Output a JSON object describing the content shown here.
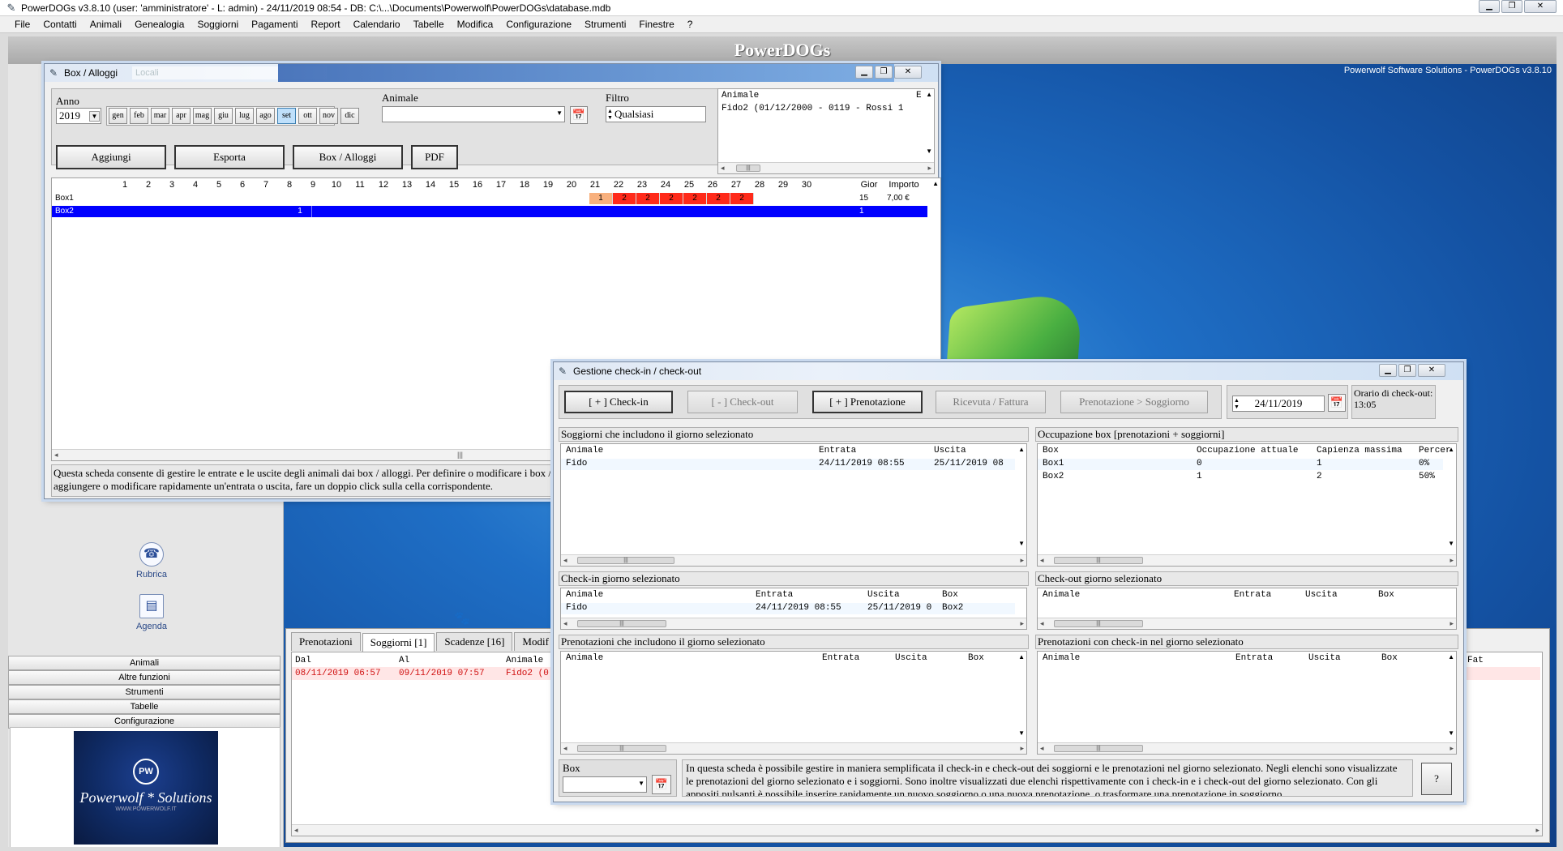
{
  "titlebar": {
    "title": "PowerDOGs v3.8.10  (user: 'amministratore'  - L: admin) - 24/11/2019 08:54 - DB: C:\\...\\Documents\\Powerwolf\\PowerDOGs\\database.mdb"
  },
  "menu": [
    "File",
    "Contatti",
    "Animali",
    "Genealogia",
    "Soggiorni",
    "Pagamenti",
    "Report",
    "Calendario",
    "Tabelle",
    "Modifica",
    "Configurazione",
    "Strumenti",
    "Finestre",
    "?"
  ],
  "banner": {
    "title": "PowerDOGs"
  },
  "desktop": {
    "caption": "Powerwolf Software Solutions - PowerDOGs v3.8.10"
  },
  "left_panel": {
    "launchers": [
      {
        "label": "Rubrica",
        "icon": "phone-icon"
      },
      {
        "label": "Agenda",
        "icon": "agenda-icon"
      }
    ],
    "nav": [
      "Animali",
      "Altre funzioni",
      "Strumenti",
      "Tabelle",
      "Configurazione"
    ],
    "logo": {
      "mark": "PW",
      "text": "Powerwolf * Solutions",
      "subtext": "WWW.POWERWOLF.IT"
    }
  },
  "bottom_tabs": {
    "tabs": [
      "Prenotazioni",
      "Soggiorni [1]",
      "Scadenze [16]",
      "Modif"
    ],
    "active": 1,
    "columns": [
      "Dal",
      "Al",
      "Animale",
      "Fat"
    ],
    "rows": [
      {
        "dal": "08/11/2019 06:57",
        "al": "09/11/2019 07:57",
        "animale": "Fido2 (0"
      }
    ]
  },
  "box_window": {
    "title": "Box / Alloggi",
    "title_extra": "Locali",
    "anno_label": "Anno",
    "anno_value": "2019",
    "months": [
      "gen",
      "feb",
      "mar",
      "apr",
      "mag",
      "giu",
      "lug",
      "ago",
      "set",
      "ott",
      "nov",
      "dic"
    ],
    "selected_month": "set",
    "animale_label": "Animale",
    "animale_value": "",
    "filtro_label": "Filtro",
    "filtro_value": "Qualsiasi",
    "animal_list_header": "Animale",
    "animal_list_header2": "E",
    "animal_list_item": "Fido2 (01/12/2000 - 0119 - Rossi  1",
    "buttons": {
      "aggiungi": "Aggiungi",
      "esporta": "Esporta",
      "box": "Box / Alloggi",
      "pdf": "PDF"
    },
    "grid": {
      "days": [
        "1",
        "2",
        "3",
        "4",
        "5",
        "6",
        "7",
        "8",
        "9",
        "10",
        "11",
        "12",
        "13",
        "14",
        "15",
        "16",
        "17",
        "18",
        "19",
        "20",
        "21",
        "22",
        "23",
        "24",
        "25",
        "26",
        "27",
        "28",
        "29",
        "30"
      ],
      "col_gior": "Gior",
      "col_importo": "Importo",
      "rows": [
        {
          "name": "Box1",
          "cells": {
            "21": "1",
            "22": "2",
            "23": "2",
            "24": "2",
            "25": "2",
            "26": "2",
            "27": "2"
          },
          "gior": "15",
          "importo": "7,00 €"
        },
        {
          "name": "Box2",
          "cells": {
            "8": "1"
          },
          "gior": "1",
          "importo": ""
        }
      ]
    },
    "help_text": "Questa scheda consente di gestire le entrate e le uscite degli animali dai box / alloggi. Per definire o modificare i box / alloggi, selezionare Tabelle > Box / Alloggi nel menù principale per l'edit dei box). Per aggiungere o modificare rapidamente un'entrata o uscita, fare un doppio click sulla cella corrispondente."
  },
  "checkin_window": {
    "title": "Gestione check-in / check-out",
    "buttons": {
      "checkin": "[ + ] Check-in",
      "checkout": "[ - ] Check-out",
      "prenotazione": "[ + ] Prenotazione",
      "ricevuta": "Ricevuta / Fattura",
      "prenot_soggiorno": "Prenotazione > Soggiorno"
    },
    "date_value": "24/11/2019",
    "orario_label": "Orario di check-out: 13:05",
    "soggiorni": {
      "title": "Soggiorni che includono il giorno selezionato",
      "columns": [
        "Animale",
        "Entrata",
        "Uscita"
      ],
      "rows": [
        [
          "Fido",
          "24/11/2019 08:55",
          "25/11/2019 08"
        ]
      ]
    },
    "occupazione": {
      "title": "Occupazione box [prenotazioni + soggiorni]",
      "columns": [
        "Box",
        "Occupazione attuale",
        "Capienza massima",
        "Percer"
      ],
      "rows": [
        [
          "Box1",
          "0",
          "1",
          "0%"
        ],
        [
          "Box2",
          "1",
          "2",
          "50%"
        ]
      ]
    },
    "checkin_list": {
      "title": "Check-in giorno selezionato",
      "columns": [
        "Animale",
        "Entrata",
        "Uscita",
        "Box"
      ],
      "rows": [
        [
          "Fido",
          "24/11/2019 08:55",
          "25/11/2019 0",
          "Box2"
        ]
      ]
    },
    "checkout_list": {
      "title": "Check-out giorno selezionato",
      "columns": [
        "Animale",
        "Entrata",
        "Uscita",
        "Box"
      ],
      "rows": []
    },
    "prenotazioni": {
      "title": "Prenotazioni che includono il giorno selezionato",
      "columns": [
        "Animale",
        "Entrata",
        "Uscita",
        "Box"
      ],
      "rows": []
    },
    "prenotazioni_checkin": {
      "title": "Prenotazioni con check-in nel giorno selezionato",
      "columns": [
        "Animale",
        "Entrata",
        "Uscita",
        "Box"
      ],
      "rows": []
    },
    "box_label": "Box",
    "box_value": "",
    "help_text": "In questa scheda è possibile gestire in maniera semplificata il check-in e check-out dei soggiorni e le prenotazioni nel giorno selezionato. Negli elenchi sono visualizzate le prenotazioni del giorno selezionato e i soggiorni. Sono inoltre visualizzati due elenchi rispettivamente con i check-in e i check-out del giorno selezionato. Con gli appositi pulsanti è possibile inserire rapidamente un nuovo soggiorno o una nuova prenotazione, o trasformare una prenotazione in soggiorno.",
    "help_button": "?"
  }
}
